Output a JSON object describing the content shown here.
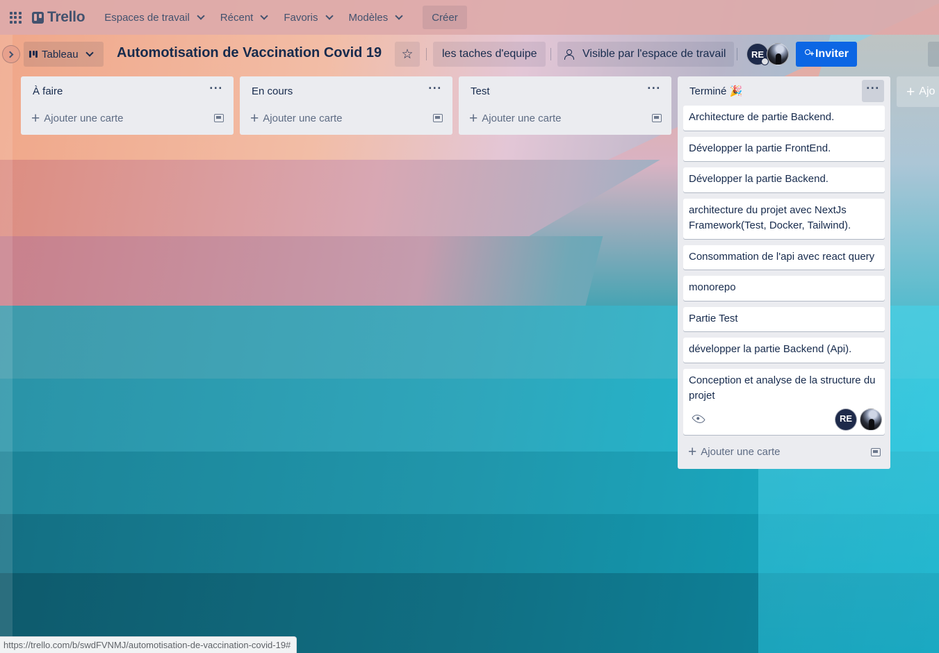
{
  "topnav": {
    "logo": "Trello",
    "menus": [
      "Espaces de travail",
      "Récent",
      "Favoris",
      "Modèles"
    ],
    "create": "Créer"
  },
  "board": {
    "view": "Tableau",
    "title": "Automotisation de Vaccination Covid 19",
    "workspace": "les taches d'equipe",
    "visibility": "Visible par l'espace de travail",
    "member_initials": "RE",
    "invite": "Inviter"
  },
  "lists": [
    {
      "title": "À faire",
      "add_card": "Ajouter une carte",
      "cards": []
    },
    {
      "title": "En cours",
      "add_card": "Ajouter une carte",
      "cards": []
    },
    {
      "title": "Test",
      "add_card": "Ajouter une carte",
      "cards": []
    },
    {
      "title": "Terminé 🎉",
      "add_card": "Ajouter une carte",
      "cards": [
        "Architecture de partie Backend.",
        "Développer la partie FrontEnd.",
        "Développer la partie Backend.",
        "architecture du projet avec NextJs Framework(Test, Docker, Tailwind).",
        "Consommation de l'api avec react query",
        "monorepo",
        "Partie Test",
        "développer la partie Backend (Api).",
        "Conception et analyse de la structure du projet"
      ],
      "last_card_member_initials": "RE"
    }
  ],
  "add_list": "Ajo",
  "status_url": "https://trello.com/b/swdFVNMJ/automotisation-de-vaccination-covid-19#",
  "colors": {
    "nav_bg": "#ddaaaa",
    "invite_bg": "#0c66e4",
    "list_bg": "#ebecf0",
    "text": "#172b4d"
  }
}
